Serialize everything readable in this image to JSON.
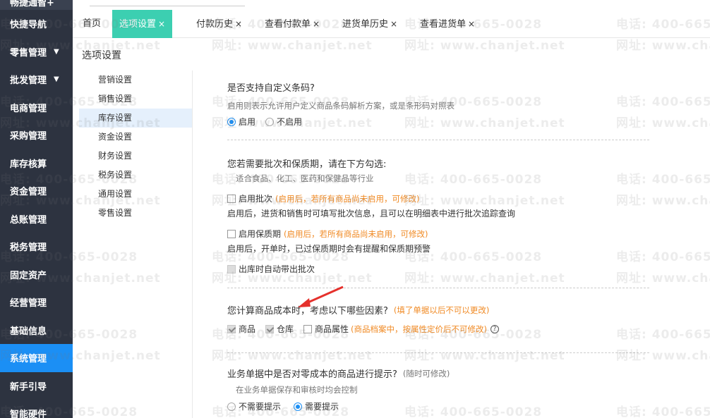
{
  "sidebar": {
    "brand": "畅捷通智+",
    "items": [
      {
        "label": "快捷导航",
        "caret": ""
      },
      {
        "label": "零售管理",
        "caret": "▼"
      },
      {
        "label": "批发管理",
        "caret": "▼"
      },
      {
        "label": "电商管理",
        "caret": ""
      },
      {
        "label": "采购管理",
        "caret": ""
      },
      {
        "label": "库存核算",
        "caret": ""
      },
      {
        "label": "资金管理",
        "caret": ""
      },
      {
        "label": "总账管理",
        "caret": ""
      },
      {
        "label": "税务管理",
        "caret": ""
      },
      {
        "label": "固定资产",
        "caret": ""
      },
      {
        "label": "经营管理",
        "caret": ""
      },
      {
        "label": "基础信息",
        "caret": ""
      },
      {
        "label": "系统管理",
        "caret": ""
      },
      {
        "label": "新手引导",
        "caret": ""
      },
      {
        "label": "智能硬件",
        "caret": ""
      }
    ],
    "active_index": 12
  },
  "tabs": [
    {
      "label": "首页",
      "close": ""
    },
    {
      "label": "选项设置",
      "close": "×"
    },
    {
      "label": "付款历史",
      "close": "×"
    },
    {
      "label": "查看付款单",
      "close": "×"
    },
    {
      "label": "进货单历史",
      "close": "×"
    },
    {
      "label": "查看进货单",
      "close": "×"
    }
  ],
  "active_tab": 1,
  "page_title": "选项设置",
  "subnav": {
    "items": [
      "营销设置",
      "销售设置",
      "库存设置",
      "资金设置",
      "财务设置",
      "税务设置",
      "通用设置",
      "零售设置"
    ],
    "active_index": 2
  },
  "barcode": {
    "question": "是否支持自定义条码?",
    "hint": "启用则表示允许用户定义商品条码解析方案，或是条形码对照表",
    "options": [
      "启用",
      "不启用"
    ],
    "selected": 0
  },
  "batch": {
    "question": "您若需要批次和保质期，请在下方勾选:",
    "hint": "适合食品、化工、医药和保健品等行业",
    "enable_batch": {
      "label": "启用批次",
      "warn": "(启用后，若所有商品尚未启用，可修改)",
      "desc": "启用后，进货和销售时可填写批次信息，且可以在明细表中进行批次追踪查询"
    },
    "enable_shelf": {
      "label": "启用保质期",
      "warn": "(启用后，若所有商品尚未启用，可修改)",
      "desc": "启用后，开单时，已过保质期时会有提醒和保质期预警"
    },
    "auto_batch": {
      "label": "出库时自动带出批次"
    }
  },
  "cost": {
    "question": "您计算商品成本时，考虑以下哪些因素?",
    "warn": "(填了单据以后不可以更改)",
    "options": [
      {
        "label": "商品",
        "checked": true,
        "disabled": true
      },
      {
        "label": "仓库",
        "checked": true,
        "disabled": true
      },
      {
        "label": "商品属性",
        "checked": false,
        "disabled": false
      }
    ],
    "attr_warn": "(商品档案中，按属性定价后不可修改)",
    "help": "?"
  },
  "zero_cost": {
    "question": "业务单据中是否对零成本的商品进行提示?",
    "note": "(随时可修改)",
    "hint": "在业务单据保存和审核时均会控制",
    "options": [
      "不需要提示",
      "需要提示"
    ],
    "selected": 1
  },
  "watermark": {
    "phone": "电话: 400-665-0028",
    "site": "网址: www.chanjet.net"
  },
  "colors": {
    "sidebar_bg": "#2d3340",
    "sidebar_active": "#1b8ff5",
    "tab_active": "#3ccfb1",
    "warn": "#f08a24",
    "arrow": "#e5312c"
  }
}
